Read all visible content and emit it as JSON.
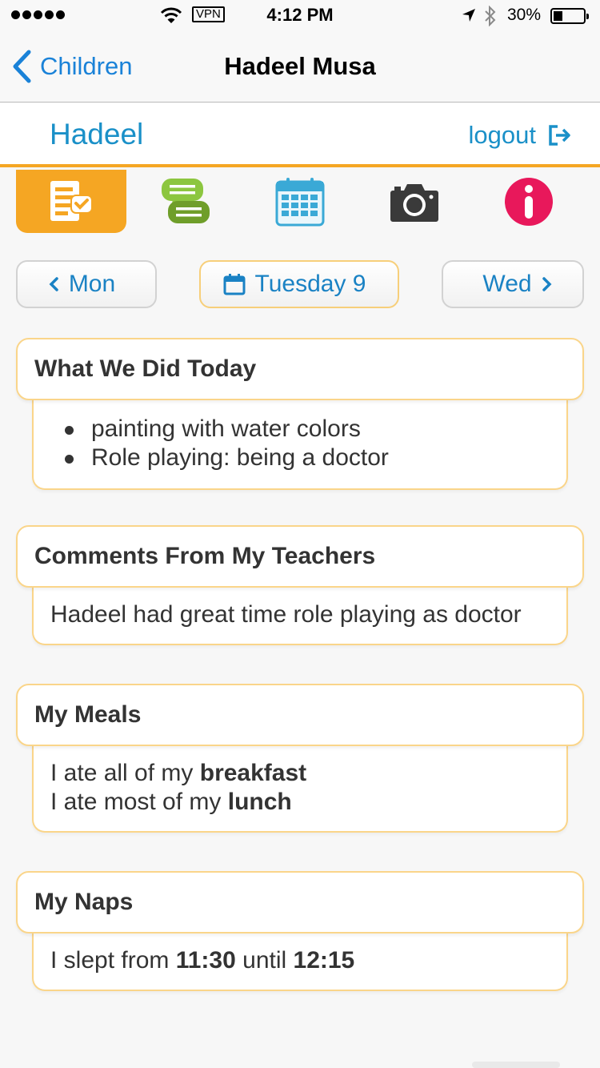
{
  "status_bar": {
    "time": "4:12 PM",
    "vpn": "VPN",
    "battery_percent": "30%",
    "battery_level": 0.3
  },
  "nav": {
    "back_label": "Children",
    "title": "Hadeel Musa"
  },
  "header": {
    "child_name": "Hadeel",
    "logout_label": "logout"
  },
  "tabs": [
    {
      "icon": "daily-report-icon",
      "active": true,
      "color": "#f5a623"
    },
    {
      "icon": "chat-icon",
      "active": false,
      "color": "#7ab02b"
    },
    {
      "icon": "calendar-icon",
      "active": false,
      "color": "#3aa9d6"
    },
    {
      "icon": "camera-icon",
      "active": false,
      "color": "#3a3a3a"
    },
    {
      "icon": "info-icon",
      "active": false,
      "color": "#e8185b"
    }
  ],
  "day_nav": {
    "prev_label": "Mon",
    "current_label": "Tuesday 9",
    "next_label": "Wed"
  },
  "cards": {
    "activities": {
      "title": "What We Did Today",
      "items": [
        "painting with water colors",
        "Role playing: being a doctor"
      ]
    },
    "comments": {
      "title": "Comments From My Teachers",
      "text": "Hadeel had great time role playing as doctor"
    },
    "meals": {
      "title": "My Meals",
      "line1_prefix": "I ate all of my ",
      "line1_meal": "breakfast",
      "line2_prefix": "I ate most of my ",
      "line2_meal": "lunch"
    },
    "naps": {
      "title": "My Naps",
      "prefix": "I slept from ",
      "start": "11:30",
      "middle": " until ",
      "end": "12:15"
    }
  },
  "colors": {
    "accent": "#f5a623",
    "link_blue": "#1a82d8",
    "card_border": "#fad58a"
  }
}
